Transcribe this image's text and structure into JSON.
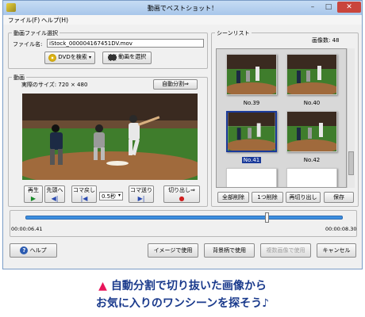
{
  "window": {
    "title": "動画でベストショット！",
    "minimize": "–",
    "maximize": "□",
    "close": "✕"
  },
  "menu": [
    "ファイル(F)",
    "ヘルプ(H)"
  ],
  "file_section": {
    "title": "動画ファイル選択",
    "file_label": "ファイル名:",
    "file_value": "iStock_000004167451DV.mov",
    "dvd_button": "DVDを検索",
    "select_button": "動画を選択"
  },
  "video_section": {
    "title": "動画",
    "size_label": "実際のサイズ: 720 × 480",
    "auto_split_button": "自動分割⇒",
    "controls": [
      {
        "label": "再生",
        "icon": "▶",
        "color": "#1a8a2a"
      },
      {
        "label": "先頭へ",
        "icon": "◀|",
        "color": "#2a4ab0"
      },
      {
        "label": "コマ戻し",
        "icon": "|◀",
        "color": "#2a4ab0"
      },
      {
        "label": "コマ送り",
        "icon": "▶|",
        "color": "#2a4ab0"
      },
      {
        "label": "切り出し⇒",
        "icon": "●",
        "color": "#d02020"
      }
    ],
    "step_select": "0.5秒"
  },
  "scene_section": {
    "title": "シーンリスト",
    "count_label": "画像数: 48",
    "thumbnails": [
      {
        "label": "No.39",
        "selected": false
      },
      {
        "label": "No.40",
        "selected": false
      },
      {
        "label": "No.41",
        "selected": true
      },
      {
        "label": "No.42",
        "selected": false
      }
    ],
    "buttons": [
      "全部削除",
      "1つ削除",
      "再切り出し",
      "保存"
    ]
  },
  "timeline": {
    "start": "00:00:06.41",
    "end": "00:00:08.30",
    "position": 0.76
  },
  "bottom_buttons": {
    "help": "ヘルプ",
    "use_image": "イメージで使用",
    "use_background": "背景柄で使用",
    "use_multiple": "複数画像で使用",
    "cancel": "キャンセル"
  },
  "caption": {
    "line1": "自動分割で切り抜いた画像から",
    "line2": "お気に入りのワンシーンを探そう♪",
    "marker": "▲"
  }
}
